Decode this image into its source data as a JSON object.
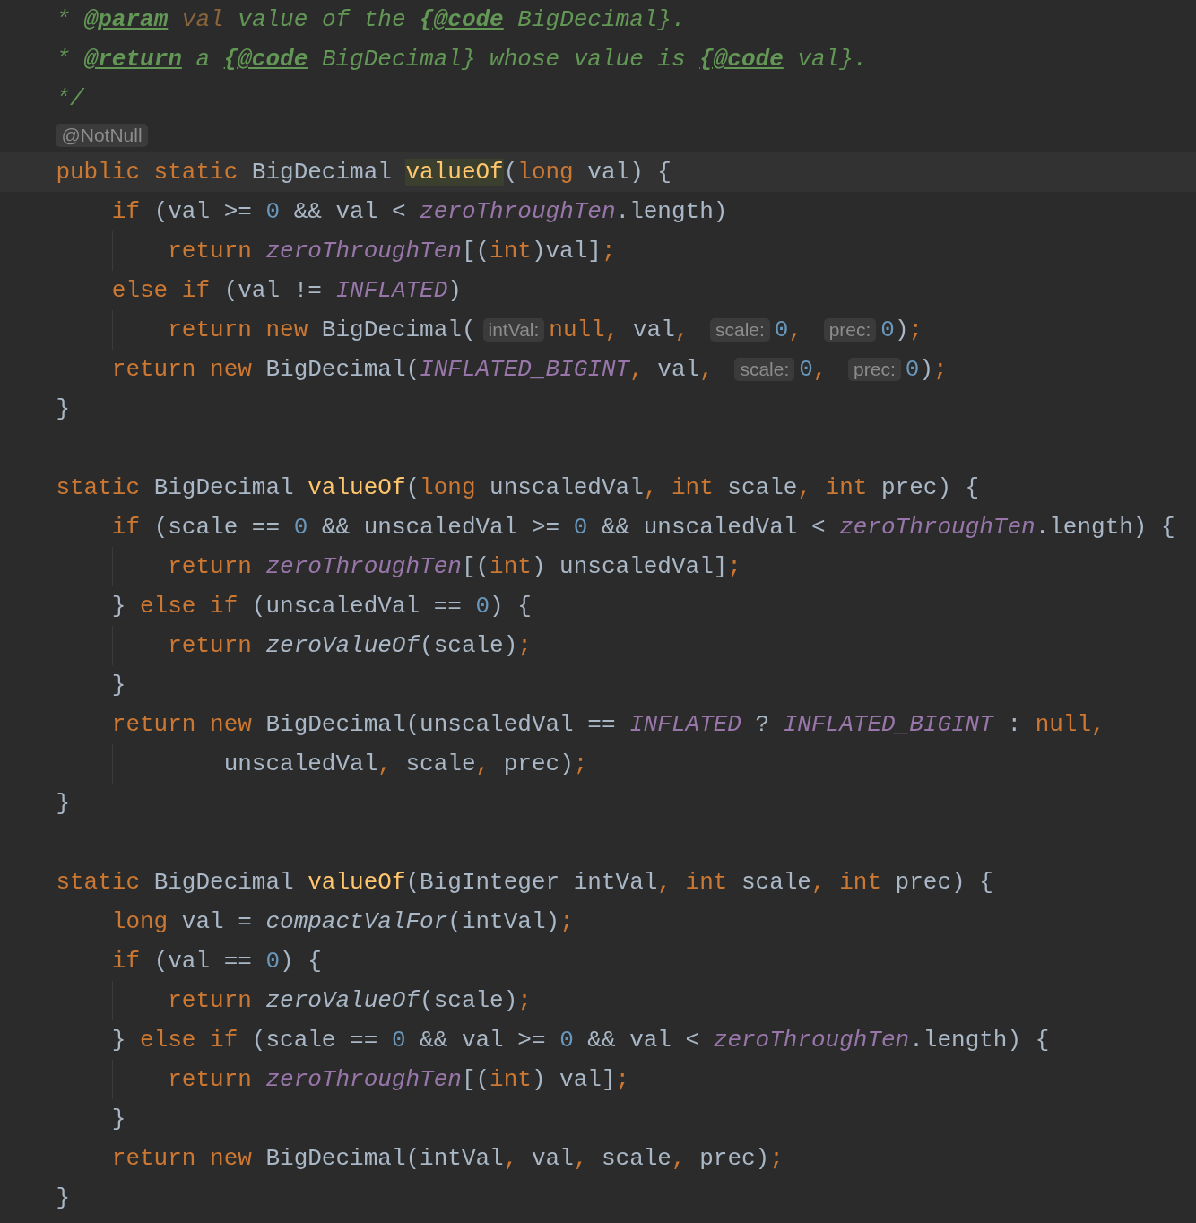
{
  "editor": {
    "blocks": [
      {
        "lines": [
          {
            "tokens": [
              {
                "kind": "comment",
                "text": "     * "
              },
              {
                "kind": "tag",
                "text": "@param"
              },
              {
                "kind": "param",
                "text": " val"
              },
              {
                "kind": "comment",
                "text": " value of the "
              },
              {
                "kind": "tag",
                "text": "{@code"
              },
              {
                "kind": "comment",
                "text": " BigDecimal}."
              }
            ]
          },
          {
            "tokens": [
              {
                "kind": "comment",
                "text": "     * "
              },
              {
                "kind": "tag",
                "text": "@return"
              },
              {
                "kind": "comment",
                "text": " a "
              },
              {
                "kind": "tag",
                "text": "{@code"
              },
              {
                "kind": "comment",
                "text": " BigDecimal} whose value is "
              },
              {
                "kind": "tag",
                "text": "{@code"
              },
              {
                "kind": "comment",
                "text": " val}."
              }
            ]
          },
          {
            "tokens": [
              {
                "kind": "comment",
                "text": "     */"
              }
            ]
          },
          {
            "tokens": [
              {
                "kind": "annotation",
                "text": "    @NotNull"
              }
            ]
          },
          {
            "current": true,
            "tokens": [
              {
                "kind": "keyword",
                "text": "    public static "
              },
              {
                "kind": "plain",
                "text": "BigDecimal "
              },
              {
                "kind": "method",
                "text": "valueOf",
                "highlighted": true
              },
              {
                "kind": "plain",
                "text": "("
              },
              {
                "kind": "keyword",
                "text": "long"
              },
              {
                "kind": "plain",
                "text": " val) {"
              }
            ]
          },
          {
            "tokens": [
              {
                "kind": "keyword",
                "text": "        if"
              },
              {
                "kind": "plain",
                "text": " (val >= "
              },
              {
                "kind": "number",
                "text": "0"
              },
              {
                "kind": "plain",
                "text": " && val < "
              },
              {
                "kind": "field",
                "text": "zeroThroughTen"
              },
              {
                "kind": "plain",
                "text": ".length)"
              }
            ]
          },
          {
            "tokens": [
              {
                "kind": "keyword",
                "text": "            return "
              },
              {
                "kind": "field",
                "text": "zeroThroughTen"
              },
              {
                "kind": "plain",
                "text": "[("
              },
              {
                "kind": "keyword",
                "text": "int"
              },
              {
                "kind": "plain",
                "text": ")val]"
              },
              {
                "kind": "keyword",
                "text": ";"
              }
            ]
          },
          {
            "tokens": [
              {
                "kind": "keyword",
                "text": "        else if"
              },
              {
                "kind": "plain",
                "text": " (val != "
              },
              {
                "kind": "field",
                "text": "INFLATED"
              },
              {
                "kind": "plain",
                "text": ")"
              }
            ]
          },
          {
            "tokens": [
              {
                "kind": "keyword",
                "text": "            return new "
              },
              {
                "kind": "plain",
                "text": "BigDecimal("
              },
              {
                "kind": "hint",
                "text": "intVal:"
              },
              {
                "kind": "keyword",
                "text": "null, "
              },
              {
                "kind": "plain",
                "text": "val"
              },
              {
                "kind": "keyword",
                "text": ", "
              },
              {
                "kind": "hint",
                "text": "scale:"
              },
              {
                "kind": "number",
                "text": "0"
              },
              {
                "kind": "keyword",
                "text": ", "
              },
              {
                "kind": "hint",
                "text": "prec:"
              },
              {
                "kind": "number",
                "text": "0"
              },
              {
                "kind": "plain",
                "text": ")"
              },
              {
                "kind": "keyword",
                "text": ";"
              }
            ]
          },
          {
            "tokens": [
              {
                "kind": "keyword",
                "text": "        return new "
              },
              {
                "kind": "plain",
                "text": "BigDecimal("
              },
              {
                "kind": "field",
                "text": "INFLATED_BIGINT"
              },
              {
                "kind": "keyword",
                "text": ", "
              },
              {
                "kind": "plain",
                "text": "val"
              },
              {
                "kind": "keyword",
                "text": ", "
              },
              {
                "kind": "hint",
                "text": "scale:"
              },
              {
                "kind": "number",
                "text": "0"
              },
              {
                "kind": "keyword",
                "text": ", "
              },
              {
                "kind": "hint",
                "text": "prec:"
              },
              {
                "kind": "number",
                "text": "0"
              },
              {
                "kind": "plain",
                "text": ")"
              },
              {
                "kind": "keyword",
                "text": ";"
              }
            ]
          },
          {
            "tokens": [
              {
                "kind": "plain",
                "text": "    }"
              }
            ]
          }
        ]
      },
      {
        "lines": [
          {
            "tokens": [
              {
                "kind": "keyword",
                "text": "    static "
              },
              {
                "kind": "plain",
                "text": "BigDecimal "
              },
              {
                "kind": "method",
                "text": "valueOf",
                "highlighted": false
              },
              {
                "kind": "plain",
                "text": "("
              },
              {
                "kind": "keyword",
                "text": "long"
              },
              {
                "kind": "plain",
                "text": " unscaledVal"
              },
              {
                "kind": "keyword",
                "text": ", int"
              },
              {
                "kind": "plain",
                "text": " scale"
              },
              {
                "kind": "keyword",
                "text": ", int"
              },
              {
                "kind": "plain",
                "text": " prec) {"
              }
            ]
          },
          {
            "tokens": [
              {
                "kind": "keyword",
                "text": "        if"
              },
              {
                "kind": "plain",
                "text": " (scale == "
              },
              {
                "kind": "number",
                "text": "0"
              },
              {
                "kind": "plain",
                "text": " && unscaledVal >= "
              },
              {
                "kind": "number",
                "text": "0"
              },
              {
                "kind": "plain",
                "text": " && unscaledVal < "
              },
              {
                "kind": "field",
                "text": "zeroThroughTen"
              },
              {
                "kind": "plain",
                "text": ".length) {"
              }
            ]
          },
          {
            "tokens": [
              {
                "kind": "keyword",
                "text": "            return "
              },
              {
                "kind": "field",
                "text": "zeroThroughTen"
              },
              {
                "kind": "plain",
                "text": "[("
              },
              {
                "kind": "keyword",
                "text": "int"
              },
              {
                "kind": "plain",
                "text": ") unscaledVal]"
              },
              {
                "kind": "keyword",
                "text": ";"
              }
            ]
          },
          {
            "tokens": [
              {
                "kind": "plain",
                "text": "        } "
              },
              {
                "kind": "keyword",
                "text": "else if"
              },
              {
                "kind": "plain",
                "text": " (unscaledVal == "
              },
              {
                "kind": "number",
                "text": "0"
              },
              {
                "kind": "plain",
                "text": ") {"
              }
            ]
          },
          {
            "tokens": [
              {
                "kind": "keyword",
                "text": "            return "
              },
              {
                "kind": "call",
                "text": "zeroValueOf"
              },
              {
                "kind": "plain",
                "text": "(scale)"
              },
              {
                "kind": "keyword",
                "text": ";"
              }
            ]
          },
          {
            "tokens": [
              {
                "kind": "plain",
                "text": "        }"
              }
            ]
          },
          {
            "tokens": [
              {
                "kind": "keyword",
                "text": "        return new "
              },
              {
                "kind": "plain",
                "text": "BigDecimal(unscaledVal == "
              },
              {
                "kind": "field",
                "text": "INFLATED"
              },
              {
                "kind": "plain",
                "text": " ? "
              },
              {
                "kind": "field",
                "text": "INFLATED_BIGINT"
              },
              {
                "kind": "plain",
                "text": " : "
              },
              {
                "kind": "keyword",
                "text": "null,"
              }
            ]
          },
          {
            "tokens": [
              {
                "kind": "plain",
                "text": "                unscaledVal"
              },
              {
                "kind": "keyword",
                "text": ", "
              },
              {
                "kind": "plain",
                "text": "scale"
              },
              {
                "kind": "keyword",
                "text": ", "
              },
              {
                "kind": "plain",
                "text": "prec)"
              },
              {
                "kind": "keyword",
                "text": ";"
              }
            ]
          },
          {
            "tokens": [
              {
                "kind": "plain",
                "text": "    }"
              }
            ]
          }
        ]
      },
      {
        "lines": [
          {
            "tokens": [
              {
                "kind": "keyword",
                "text": "    static "
              },
              {
                "kind": "plain",
                "text": "BigDecimal "
              },
              {
                "kind": "method",
                "text": "valueOf",
                "highlighted": false
              },
              {
                "kind": "plain",
                "text": "(BigInteger intVal"
              },
              {
                "kind": "keyword",
                "text": ", int"
              },
              {
                "kind": "plain",
                "text": " scale"
              },
              {
                "kind": "keyword",
                "text": ", int"
              },
              {
                "kind": "plain",
                "text": " prec) {"
              }
            ]
          },
          {
            "tokens": [
              {
                "kind": "keyword",
                "text": "        long"
              },
              {
                "kind": "plain",
                "text": " val = "
              },
              {
                "kind": "call",
                "text": "compactValFor"
              },
              {
                "kind": "plain",
                "text": "(intVal)"
              },
              {
                "kind": "keyword",
                "text": ";"
              }
            ]
          },
          {
            "tokens": [
              {
                "kind": "keyword",
                "text": "        if"
              },
              {
                "kind": "plain",
                "text": " (val == "
              },
              {
                "kind": "number",
                "text": "0"
              },
              {
                "kind": "plain",
                "text": ") {"
              }
            ]
          },
          {
            "tokens": [
              {
                "kind": "keyword",
                "text": "            return "
              },
              {
                "kind": "call",
                "text": "zeroValueOf"
              },
              {
                "kind": "plain",
                "text": "(scale)"
              },
              {
                "kind": "keyword",
                "text": ";"
              }
            ]
          },
          {
            "tokens": [
              {
                "kind": "plain",
                "text": "        } "
              },
              {
                "kind": "keyword",
                "text": "else if"
              },
              {
                "kind": "plain",
                "text": " (scale == "
              },
              {
                "kind": "number",
                "text": "0"
              },
              {
                "kind": "plain",
                "text": " && val >= "
              },
              {
                "kind": "number",
                "text": "0"
              },
              {
                "kind": "plain",
                "text": " && val < "
              },
              {
                "kind": "field",
                "text": "zeroThroughTen"
              },
              {
                "kind": "plain",
                "text": ".length) {"
              }
            ]
          },
          {
            "tokens": [
              {
                "kind": "keyword",
                "text": "            return "
              },
              {
                "kind": "field",
                "text": "zeroThroughTen"
              },
              {
                "kind": "plain",
                "text": "[("
              },
              {
                "kind": "keyword",
                "text": "int"
              },
              {
                "kind": "plain",
                "text": ") val]"
              },
              {
                "kind": "keyword",
                "text": ";"
              }
            ]
          },
          {
            "tokens": [
              {
                "kind": "plain",
                "text": "        }"
              }
            ]
          },
          {
            "tokens": [
              {
                "kind": "keyword",
                "text": "        return new "
              },
              {
                "kind": "plain",
                "text": "BigDecimal(intVal"
              },
              {
                "kind": "keyword",
                "text": ", "
              },
              {
                "kind": "plain",
                "text": "val"
              },
              {
                "kind": "keyword",
                "text": ", "
              },
              {
                "kind": "plain",
                "text": "scale"
              },
              {
                "kind": "keyword",
                "text": ", "
              },
              {
                "kind": "plain",
                "text": "prec)"
              },
              {
                "kind": "keyword",
                "text": ";"
              }
            ]
          },
          {
            "tokens": [
              {
                "kind": "plain",
                "text": "    }"
              }
            ]
          }
        ]
      }
    ]
  }
}
